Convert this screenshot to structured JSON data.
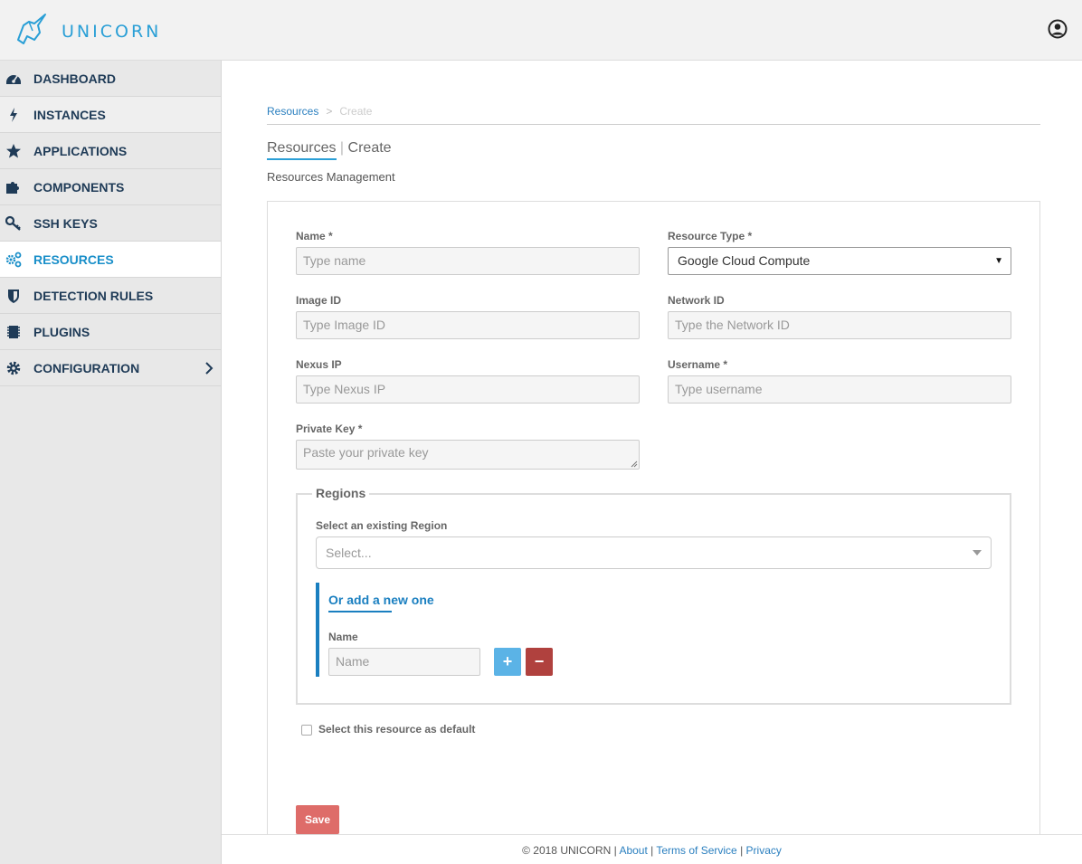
{
  "header": {
    "brand": "UNICORN"
  },
  "sidebar": {
    "items": [
      {
        "label": "DASHBOARD",
        "icon": "dashboard-icon"
      },
      {
        "label": "INSTANCES",
        "icon": "bolt-icon"
      },
      {
        "label": "APPLICATIONS",
        "icon": "star-icon"
      },
      {
        "label": "COMPONENTS",
        "icon": "puzzle-icon"
      },
      {
        "label": "SSH KEYS",
        "icon": "key-icon"
      },
      {
        "label": "RESOURCES",
        "icon": "gears-icon",
        "active": true
      },
      {
        "label": "DETECTION RULES",
        "icon": "shield-icon"
      },
      {
        "label": "PLUGINS",
        "icon": "chip-icon"
      },
      {
        "label": "CONFIGURATION",
        "icon": "gear-icon"
      }
    ]
  },
  "breadcrumb": {
    "link": "Resources",
    "current": "Create"
  },
  "page": {
    "title_part1": "Resources",
    "title_sep": " | ",
    "title_part2": "Create",
    "subtitle": "Resources Management"
  },
  "form": {
    "name": {
      "label": "Name *",
      "placeholder": "Type name"
    },
    "resource_type": {
      "label": "Resource Type *",
      "value": "Google Cloud Compute"
    },
    "image_id": {
      "label": "Image ID",
      "placeholder": "Type Image ID"
    },
    "network_id": {
      "label": "Network ID",
      "placeholder": "Type the Network ID"
    },
    "nexus_ip": {
      "label": "Nexus IP",
      "placeholder": "Type Nexus IP"
    },
    "username": {
      "label": "Username *",
      "placeholder": "Type username"
    },
    "private_key": {
      "label": "Private Key *",
      "placeholder": "Paste your private key"
    },
    "regions": {
      "legend": "Regions",
      "select_label": "Select an existing Region",
      "select_placeholder": "Select...",
      "new_title": "Or add a new one",
      "new_name_label": "Name",
      "new_name_placeholder": "Name",
      "add_symbol": "+",
      "remove_symbol": "−"
    },
    "default_label": "Select this resource as default",
    "save_label": "Save"
  },
  "footer": {
    "copyright": "© 2018 UNICORN",
    "sep": " | ",
    "links": [
      "About",
      "Terms of Service",
      "Privacy"
    ]
  },
  "colors": {
    "accent": "#2a9fd6",
    "danger": "#d9534f",
    "add_button": "#5bb3e6",
    "remove_button": "#b0413e"
  }
}
